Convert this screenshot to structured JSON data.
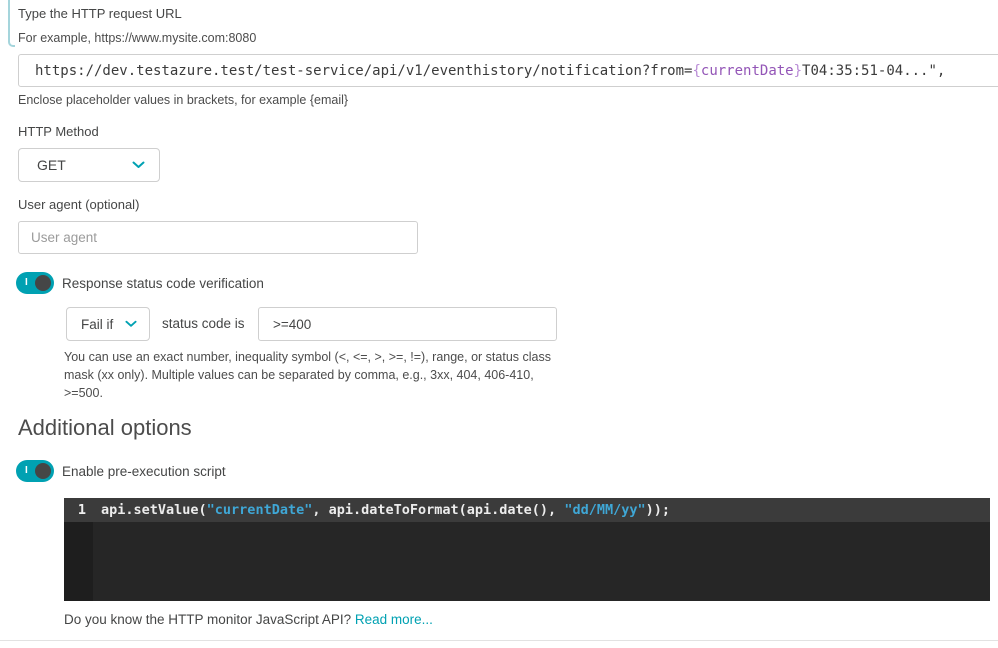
{
  "url_section": {
    "label": "Type the HTTP request URL",
    "example": "For example, https://www.mysite.com:8080",
    "url_prefix": "https://dev.testazure.test/test-service/api/v1/eventhistory/notification?from=",
    "brace_open": "{",
    "placeholder_token": "currentDate",
    "brace_close": "}",
    "url_suffix": "T04:35:51-04...\",",
    "hint": "Enclose placeholder values in brackets, for example {email}"
  },
  "http_method": {
    "label": "HTTP Method",
    "value": "GET"
  },
  "user_agent": {
    "label": "User agent (optional)",
    "placeholder": "User agent"
  },
  "status_verification": {
    "toggle_state": "on",
    "toggle_mark": "I",
    "label": "Response status code verification",
    "fail_if_value": "Fail if",
    "middle_label": "status code is",
    "status_code_value": ">=400",
    "hint_line1": "You can use an exact number, inequality symbol (<, <=, >, >=, !=), range, or status class",
    "hint_line2": "mask (xx only). Multiple values can be separated by comma, e.g., 3xx, 404, 406-410,",
    "hint_line3": ">=500."
  },
  "additional_options": {
    "heading": "Additional options",
    "pre_execution": {
      "toggle_state": "on",
      "toggle_mark": "I",
      "label": "Enable pre-execution script"
    },
    "code_editor": {
      "line_number": "1",
      "part1": "api.setValue(",
      "string1": "\"currentDate\"",
      "part2": ", api.dateToFormat(api.date(), ",
      "string2": "\"dd/MM/yy\"",
      "part3": "));"
    },
    "footer_text": "Do you know the HTTP monitor JavaScript API? ",
    "footer_link": "Read more..."
  },
  "colors": {
    "accent_teal": "#00a1b2",
    "toggle_knob": "#454646",
    "placeholder_purple": "#9355b7",
    "brace_purple": "#b98bd6",
    "code_string_blue": "#3fa7d6",
    "editor_active_line": "#3b3b3b",
    "editor_gutter": "#1e1e1e",
    "editor_bg": "#262626",
    "bracket_teal": "#a5d5dc"
  }
}
